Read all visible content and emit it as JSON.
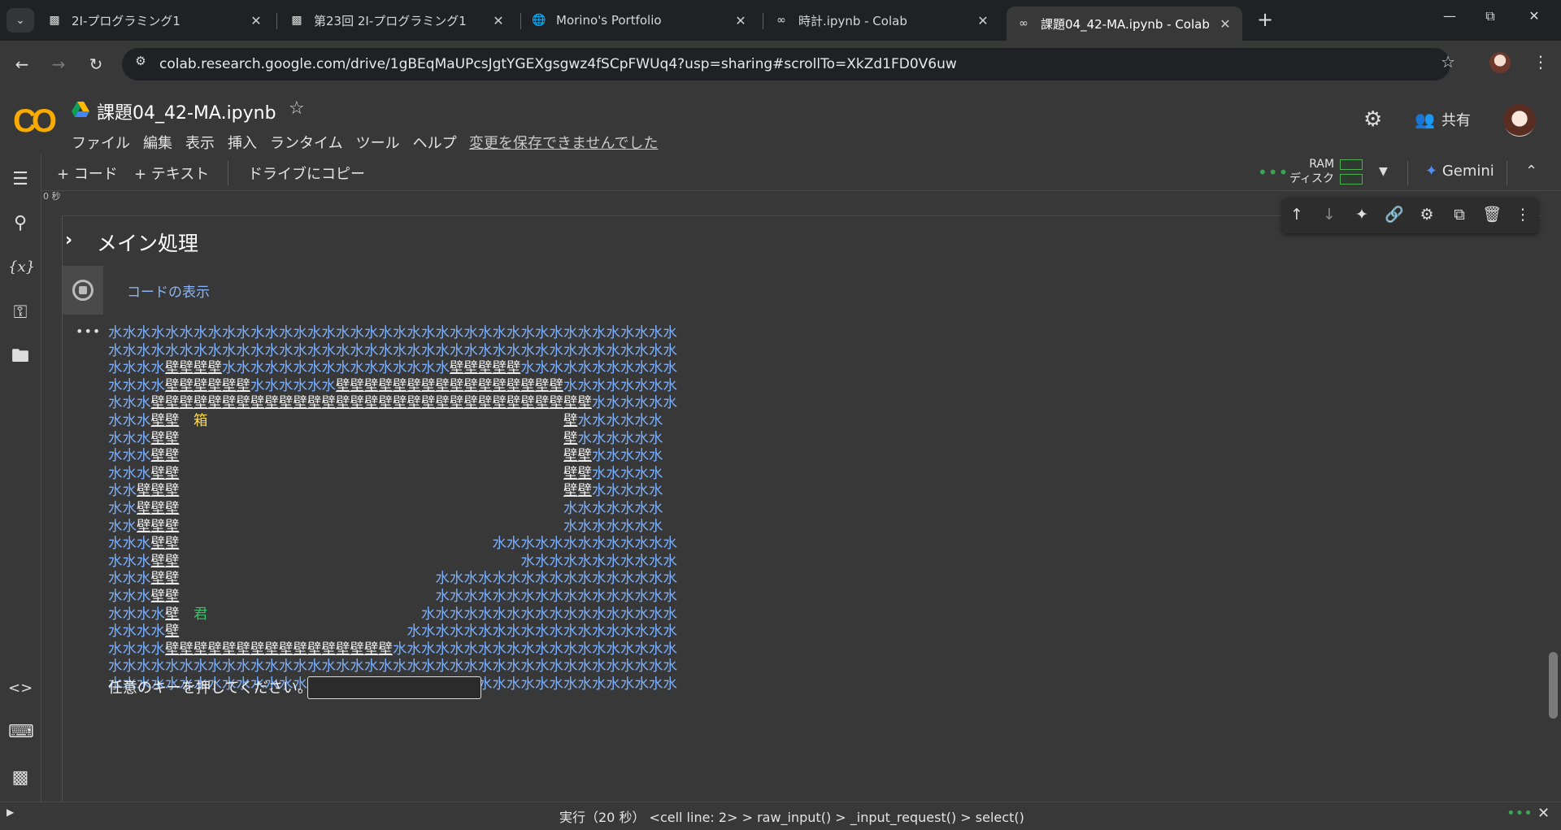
{
  "browser": {
    "tabs": [
      {
        "title": "2I-プログラミング1",
        "icon": "terminal-icon",
        "active": false
      },
      {
        "title": "第23回 2I-プログラミング1",
        "icon": "terminal-icon",
        "active": false
      },
      {
        "title": "Morino's Portfolio",
        "icon": "globe-icon",
        "active": false
      },
      {
        "title": "時計.ipynb - Colab",
        "icon": "colab-icon",
        "active": false
      },
      {
        "title": "課題04_42-MA.ipynb - Colab",
        "icon": "colab-icon",
        "active": true
      }
    ],
    "url": "colab.research.google.com/drive/1gBEqMaUPcsJgtYGEXgsgwz4fSCpFWUq4?usp=sharing#scrollTo=XkZd1FD0V6uw"
  },
  "colab": {
    "logo": "CO",
    "notebook_title": "課題04_42-MA.ipynb",
    "menu": [
      "ファイル",
      "編集",
      "表示",
      "挿入",
      "ランタイム",
      "ツール",
      "ヘルプ"
    ],
    "save_warning": "変更を保存できませんでした",
    "share_label": "共有"
  },
  "cell_toolbar": {
    "add_code": "+ コード",
    "add_text": "+ テキスト",
    "copy_to_drive": "ドライブにコピー",
    "ram_label": "RAM",
    "disk_label": "ディスク",
    "gemini_label": "Gemini"
  },
  "cell": {
    "prev_exec_time": "0 秒",
    "section_title": "メイン処理",
    "show_code": "コードの表示"
  },
  "game": {
    "legend": {
      "W": "水",
      "K": "壁",
      "B": "箱",
      "P": "君",
      ".": " "
    },
    "colors": {
      "water": "#7ab0ff",
      "wall": "#eeeeee",
      "box": "#ffd84a",
      "player": "#3fc06a"
    },
    "rows": [
      "WWWWWWWWWWWWWWWWWWWWWWWWWWWWWWWWWWWWWWWW",
      "WWWWWWWWWWWWWWWWWWWWWWWWWWWWWWWWWWWWWWWW",
      "WWWWKKKKWWWWWWWWWWWWWWWWKKKKKWWWWWWWWWWW",
      "WWWWKKKKKKWWWWWWKKKKKKKKKKKKKKKKWWWWWWWW",
      "WWWKKKKKKKKKKKKKKKKKKKKKKKKKKKKKKKWWWWWW",
      "WWWKK.B.........................KWWWWWW",
      "WWWKK...........................KWWWWWW",
      "WWWKK...........................KKWWWWW",
      "WWWKK...........................KKWWWWW",
      "WWKKK...........................KKWWWWW",
      "WWKKK...........................WWWWWWW",
      "WWKKK...........................WWWWWWW",
      "WWWKK......................WWWWWWWWWWWWW",
      "WWWKK........................WWWWWWWWWWW",
      "WWWKK..................WWWWWWWWWWWWWWWWW",
      "WWWKK..................WWWWWWWWWWWWWWWWW",
      "WWWWK.P...............WWWWWWWWWWWWWWWWWW",
      "WWWWK................WWWWWWWWWWWWWWWWWWW",
      "WWWWKKKKKKKKKKKKKKKKWWWWWWWWWWWWWWWWWWWW",
      "WWWWWWWWWWWWWWWWWWWWWWWWWWWWWWWWWWWWWWWW",
      "WWWWWWWWWWWWWWWWWWWWWWWWWWWWWWWWWWWWWWWW"
    ],
    "prompt": "任意のキーを押してください。",
    "input_value": ""
  },
  "statusbar": {
    "text": "実行（20 秒）  <cell line: 2> > raw_input() > _input_request() > select()"
  }
}
